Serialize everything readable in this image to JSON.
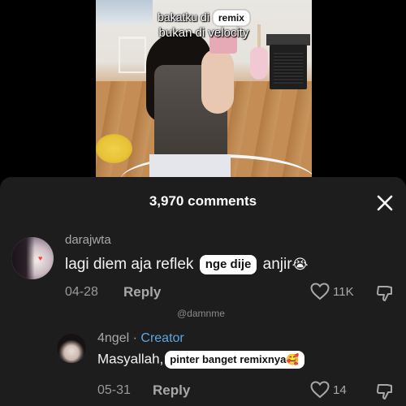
{
  "video": {
    "caption_line1_prefix": "bakatku di",
    "caption_sticker": "remix",
    "caption_line2": "bukan di velocity"
  },
  "comments_sheet": {
    "title": "3,970 comments",
    "close_icon": "close-icon"
  },
  "comments": [
    {
      "username": "darajwta",
      "text_before": "lagi diem aja reflek",
      "sticker": "nge dije",
      "text_after": "anjir",
      "emoji": "😭",
      "date": "04-28",
      "reply_label": "Reply",
      "likes": "11K"
    },
    {
      "username": "4ngel",
      "separator": "·",
      "badge": "Creator",
      "text_before": "Masyallah,",
      "sticker": "pinter banget remixnya",
      "emoji": "🥰",
      "date": "05-31",
      "reply_label": "Reply",
      "likes": "14"
    }
  ],
  "watermark": "@damnme",
  "colors": {
    "sheet_bg": "#1d1d1d",
    "creator_badge": "#5aa7e6",
    "muted_text": "#a8a8a8",
    "primary_text": "#f2f2f2"
  }
}
